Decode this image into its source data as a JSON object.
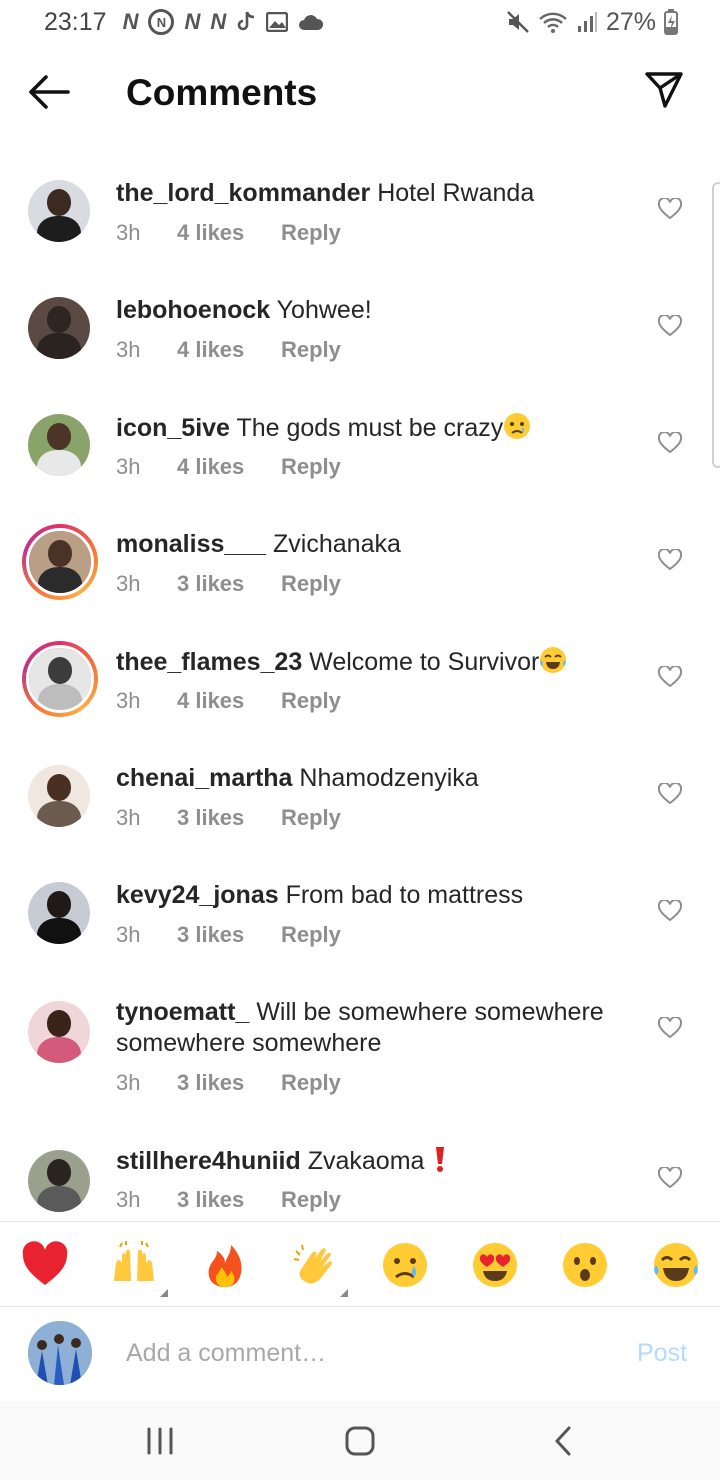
{
  "status_bar": {
    "time": "23:17",
    "notification_icons": [
      "N",
      "N",
      "N",
      "N"
    ],
    "battery": "27%"
  },
  "header": {
    "title": "Comments"
  },
  "comments": [
    {
      "username": "the_lord_kommander",
      "text": " Hotel Rwanda",
      "emoji": "",
      "time": "3h",
      "likes": "4 likes",
      "reply": "Reply"
    },
    {
      "username": "lebohoenock",
      "text": " Yohwee!",
      "emoji": "",
      "time": "3h",
      "likes": "4 likes",
      "reply": "Reply"
    },
    {
      "username": "icon_5ive",
      "text": " The gods must be crazy",
      "emoji": "crying-face",
      "time": "3h",
      "likes": "4 likes",
      "reply": "Reply"
    },
    {
      "username": "monaliss___",
      "text": " Zvichanaka",
      "emoji": "",
      "time": "3h",
      "likes": "3 likes",
      "reply": "Reply"
    },
    {
      "username": "thee_flames_23",
      "text": " Welcome to Survivor",
      "emoji": "tears-of-joy",
      "time": "3h",
      "likes": "4 likes",
      "reply": "Reply"
    },
    {
      "username": "chenai_martha",
      "text": " Nhamodzenyika",
      "emoji": "",
      "time": "3h",
      "likes": "3 likes",
      "reply": "Reply"
    },
    {
      "username": "kevy24_jonas",
      "text": " From bad to mattress",
      "emoji": "",
      "time": "3h",
      "likes": "3 likes",
      "reply": "Reply"
    },
    {
      "username": "tynoematt_",
      "text": " Will be somewhere somewhere somewhere somewhere",
      "emoji": "",
      "time": "3h",
      "likes": "3 likes",
      "reply": "Reply"
    },
    {
      "username": "stillhere4huniid",
      "text": " Zvakaoma ",
      "emoji": "exclamation",
      "time": "3h",
      "likes": "3 likes",
      "reply": "Reply"
    }
  ],
  "reactions": [
    "red-heart",
    "raising-hands",
    "fire",
    "clapping-hands",
    "crying-face",
    "heart-eyes",
    "surprised-face",
    "tears-of-joy"
  ],
  "compose": {
    "placeholder": "Add a comment…",
    "post_label": "Post"
  },
  "colors": {
    "text": "#262626",
    "meta": "#8e8e8e",
    "post_disabled": "#b3dbff",
    "story_ring": "#e1306c"
  }
}
